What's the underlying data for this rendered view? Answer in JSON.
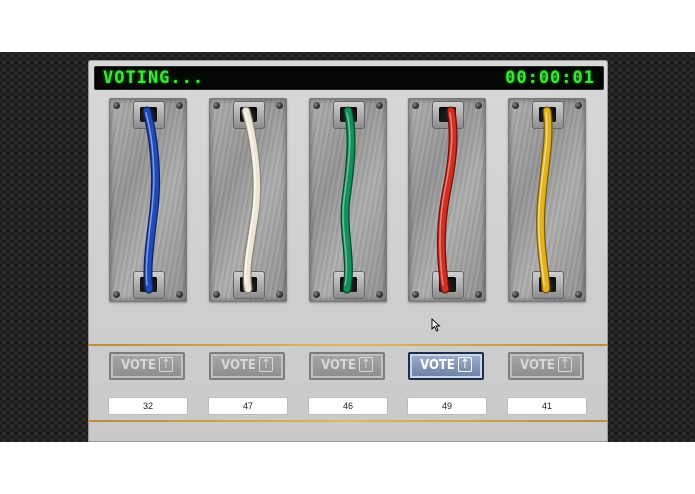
{
  "status_label": "VOTING...",
  "timer": "00:00:01",
  "vote_label": "VOTE",
  "options": [
    {
      "color_name": "blue",
      "cable_color": "#1e4bb8",
      "votes": "32",
      "selected": false
    },
    {
      "color_name": "white",
      "cable_color": "#ece6d6",
      "votes": "47",
      "selected": false
    },
    {
      "color_name": "green",
      "cable_color": "#13905a",
      "votes": "46",
      "selected": false
    },
    {
      "color_name": "red",
      "cable_color": "#d22d1e",
      "votes": "49",
      "selected": true
    },
    {
      "color_name": "yellow",
      "cable_color": "#e3b21c",
      "votes": "41",
      "selected": false
    }
  ],
  "icons": {
    "vote_button_icon": "arrow-up-icon"
  },
  "colors": {
    "display_text": "#3fe23a",
    "divider": "#e0b760",
    "selected_button": "#6c7fa3"
  }
}
